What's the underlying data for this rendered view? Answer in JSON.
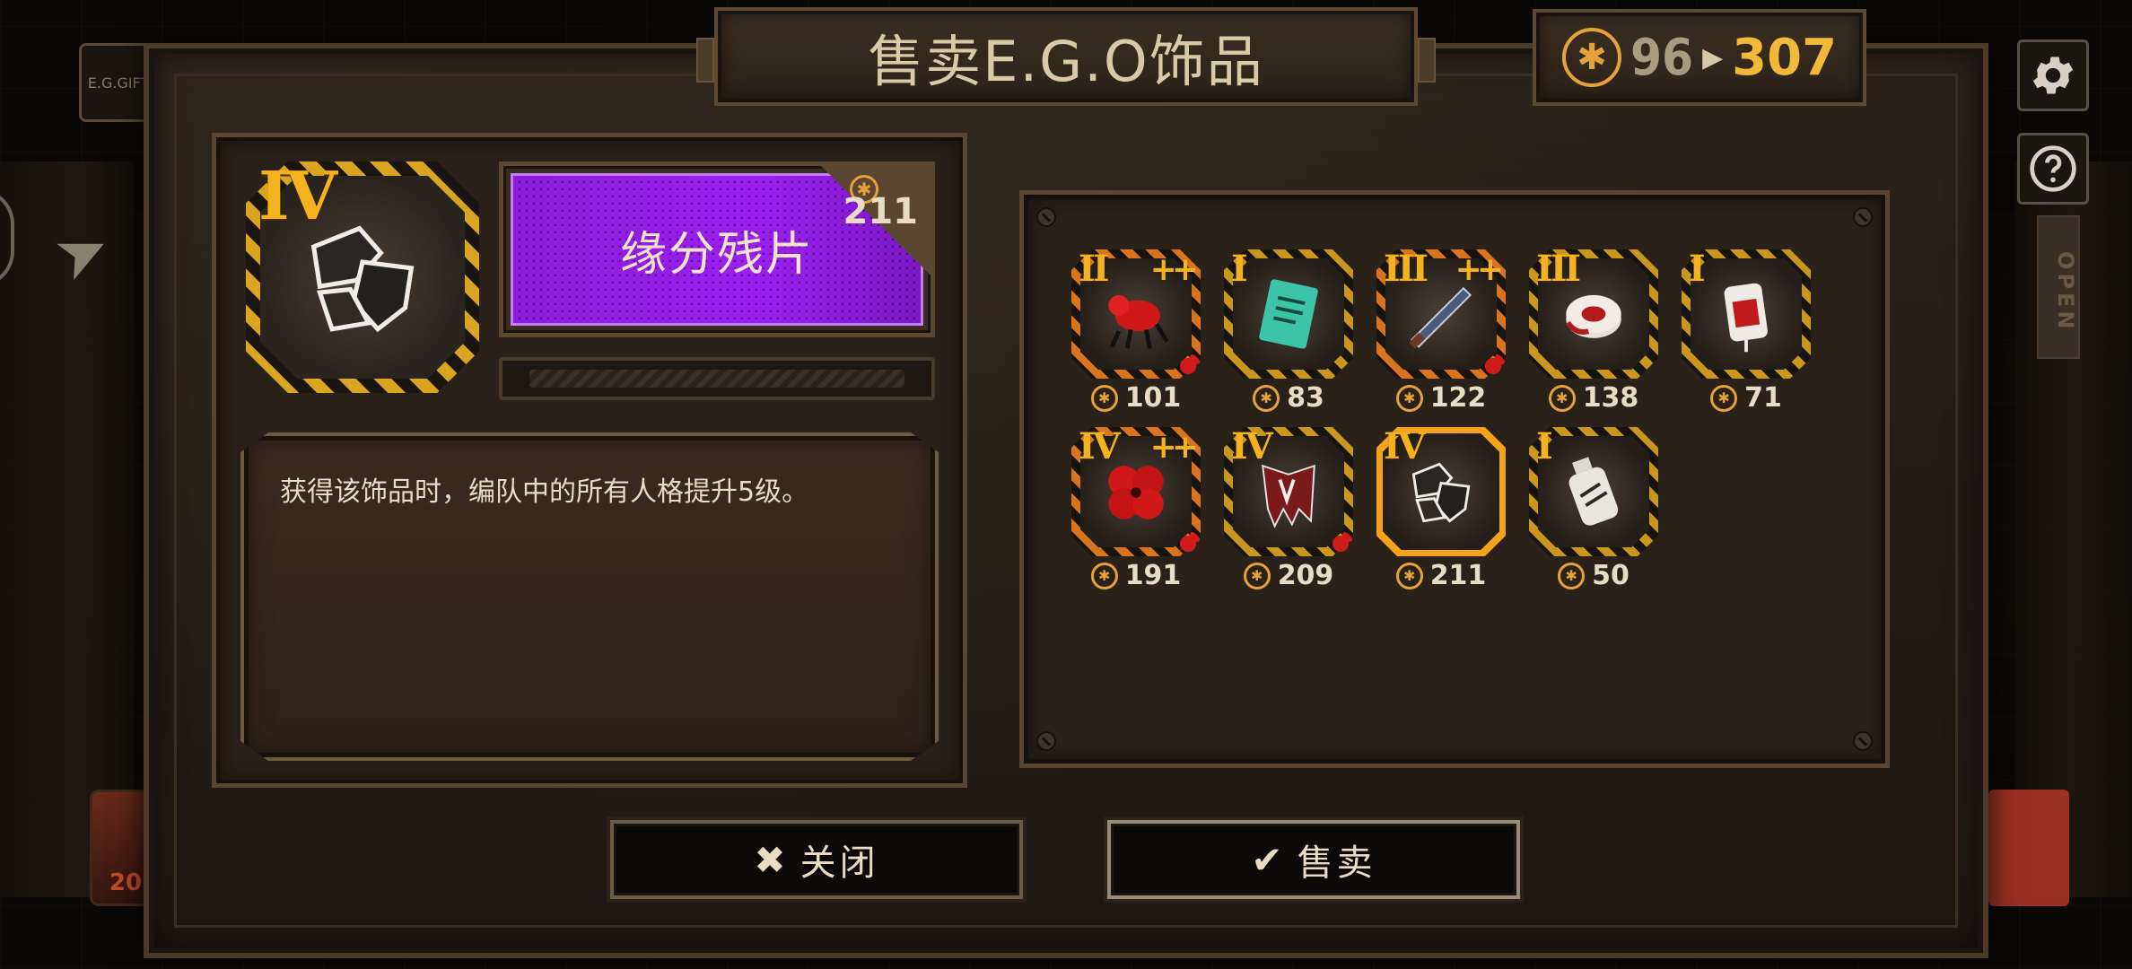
{
  "window": {
    "title": "售卖E.G.O饰品"
  },
  "currency": {
    "current": "96",
    "after": "307"
  },
  "background": {
    "gift_label": "E.G.GIFT",
    "open_sign": "OPEN",
    "left_badge_value": "20"
  },
  "detail": {
    "tier": "IV",
    "name": "缘分残片",
    "price": "211",
    "description": "获得该饰品时，编队中的所有人格提升5级。",
    "banner_color": "#9a20f0"
  },
  "inventory": {
    "items": [
      {
        "tier": "II",
        "plus": "++",
        "price": "101",
        "icon": "red-beast-icon",
        "frame": "orange",
        "splat": true
      },
      {
        "tier": "I",
        "plus": "",
        "price": "83",
        "icon": "green-card-icon",
        "frame": "normal",
        "splat": false
      },
      {
        "tier": "III",
        "plus": "++",
        "price": "122",
        "icon": "blade-icon",
        "frame": "orange",
        "splat": true
      },
      {
        "tier": "III",
        "plus": "",
        "price": "138",
        "icon": "bandage-roll-icon",
        "frame": "normal",
        "splat": false
      },
      {
        "tier": "I",
        "plus": "",
        "price": "71",
        "icon": "blood-bag-icon",
        "frame": "normal",
        "splat": false
      },
      {
        "tier": "IV",
        "plus": "++",
        "price": "191",
        "icon": "red-flower-icon",
        "frame": "orange",
        "splat": true
      },
      {
        "tier": "IV",
        "plus": "",
        "price": "209",
        "icon": "shredded-cloak-icon",
        "frame": "normal",
        "splat": true
      },
      {
        "tier": "IV",
        "plus": "",
        "price": "211",
        "icon": "fragment-icon",
        "frame": "selected",
        "splat": false
      },
      {
        "tier": "I",
        "plus": "",
        "price": "50",
        "icon": "bottle-icon",
        "frame": "normal",
        "splat": false
      }
    ]
  },
  "buttons": {
    "close_label": "关闭",
    "sell_label": "售卖"
  },
  "colors": {
    "accent_gold": "#f3b21e",
    "coin": "#e6a23a",
    "panel": "#2a2118",
    "rarity_purple": "#9a20f0"
  }
}
